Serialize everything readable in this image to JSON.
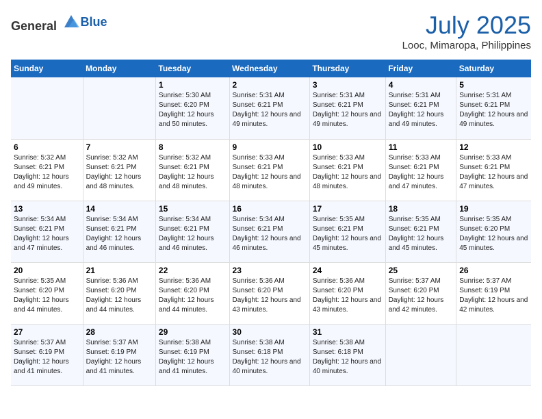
{
  "header": {
    "logo_general": "General",
    "logo_blue": "Blue",
    "month_year": "July 2025",
    "location": "Looc, Mimaropa, Philippines"
  },
  "days_of_week": [
    "Sunday",
    "Monday",
    "Tuesday",
    "Wednesday",
    "Thursday",
    "Friday",
    "Saturday"
  ],
  "weeks": [
    [
      {
        "day": "",
        "info": ""
      },
      {
        "day": "",
        "info": ""
      },
      {
        "day": "1",
        "info": "Sunrise: 5:30 AM\nSunset: 6:20 PM\nDaylight: 12 hours and 50 minutes."
      },
      {
        "day": "2",
        "info": "Sunrise: 5:31 AM\nSunset: 6:21 PM\nDaylight: 12 hours and 49 minutes."
      },
      {
        "day": "3",
        "info": "Sunrise: 5:31 AM\nSunset: 6:21 PM\nDaylight: 12 hours and 49 minutes."
      },
      {
        "day": "4",
        "info": "Sunrise: 5:31 AM\nSunset: 6:21 PM\nDaylight: 12 hours and 49 minutes."
      },
      {
        "day": "5",
        "info": "Sunrise: 5:31 AM\nSunset: 6:21 PM\nDaylight: 12 hours and 49 minutes."
      }
    ],
    [
      {
        "day": "6",
        "info": "Sunrise: 5:32 AM\nSunset: 6:21 PM\nDaylight: 12 hours and 49 minutes."
      },
      {
        "day": "7",
        "info": "Sunrise: 5:32 AM\nSunset: 6:21 PM\nDaylight: 12 hours and 48 minutes."
      },
      {
        "day": "8",
        "info": "Sunrise: 5:32 AM\nSunset: 6:21 PM\nDaylight: 12 hours and 48 minutes."
      },
      {
        "day": "9",
        "info": "Sunrise: 5:33 AM\nSunset: 6:21 PM\nDaylight: 12 hours and 48 minutes."
      },
      {
        "day": "10",
        "info": "Sunrise: 5:33 AM\nSunset: 6:21 PM\nDaylight: 12 hours and 48 minutes."
      },
      {
        "day": "11",
        "info": "Sunrise: 5:33 AM\nSunset: 6:21 PM\nDaylight: 12 hours and 47 minutes."
      },
      {
        "day": "12",
        "info": "Sunrise: 5:33 AM\nSunset: 6:21 PM\nDaylight: 12 hours and 47 minutes."
      }
    ],
    [
      {
        "day": "13",
        "info": "Sunrise: 5:34 AM\nSunset: 6:21 PM\nDaylight: 12 hours and 47 minutes."
      },
      {
        "day": "14",
        "info": "Sunrise: 5:34 AM\nSunset: 6:21 PM\nDaylight: 12 hours and 46 minutes."
      },
      {
        "day": "15",
        "info": "Sunrise: 5:34 AM\nSunset: 6:21 PM\nDaylight: 12 hours and 46 minutes."
      },
      {
        "day": "16",
        "info": "Sunrise: 5:34 AM\nSunset: 6:21 PM\nDaylight: 12 hours and 46 minutes."
      },
      {
        "day": "17",
        "info": "Sunrise: 5:35 AM\nSunset: 6:21 PM\nDaylight: 12 hours and 45 minutes."
      },
      {
        "day": "18",
        "info": "Sunrise: 5:35 AM\nSunset: 6:21 PM\nDaylight: 12 hours and 45 minutes."
      },
      {
        "day": "19",
        "info": "Sunrise: 5:35 AM\nSunset: 6:20 PM\nDaylight: 12 hours and 45 minutes."
      }
    ],
    [
      {
        "day": "20",
        "info": "Sunrise: 5:35 AM\nSunset: 6:20 PM\nDaylight: 12 hours and 44 minutes."
      },
      {
        "day": "21",
        "info": "Sunrise: 5:36 AM\nSunset: 6:20 PM\nDaylight: 12 hours and 44 minutes."
      },
      {
        "day": "22",
        "info": "Sunrise: 5:36 AM\nSunset: 6:20 PM\nDaylight: 12 hours and 44 minutes."
      },
      {
        "day": "23",
        "info": "Sunrise: 5:36 AM\nSunset: 6:20 PM\nDaylight: 12 hours and 43 minutes."
      },
      {
        "day": "24",
        "info": "Sunrise: 5:36 AM\nSunset: 6:20 PM\nDaylight: 12 hours and 43 minutes."
      },
      {
        "day": "25",
        "info": "Sunrise: 5:37 AM\nSunset: 6:20 PM\nDaylight: 12 hours and 42 minutes."
      },
      {
        "day": "26",
        "info": "Sunrise: 5:37 AM\nSunset: 6:19 PM\nDaylight: 12 hours and 42 minutes."
      }
    ],
    [
      {
        "day": "27",
        "info": "Sunrise: 5:37 AM\nSunset: 6:19 PM\nDaylight: 12 hours and 41 minutes."
      },
      {
        "day": "28",
        "info": "Sunrise: 5:37 AM\nSunset: 6:19 PM\nDaylight: 12 hours and 41 minutes."
      },
      {
        "day": "29",
        "info": "Sunrise: 5:38 AM\nSunset: 6:19 PM\nDaylight: 12 hours and 41 minutes."
      },
      {
        "day": "30",
        "info": "Sunrise: 5:38 AM\nSunset: 6:18 PM\nDaylight: 12 hours and 40 minutes."
      },
      {
        "day": "31",
        "info": "Sunrise: 5:38 AM\nSunset: 6:18 PM\nDaylight: 12 hours and 40 minutes."
      },
      {
        "day": "",
        "info": ""
      },
      {
        "day": "",
        "info": ""
      }
    ]
  ]
}
